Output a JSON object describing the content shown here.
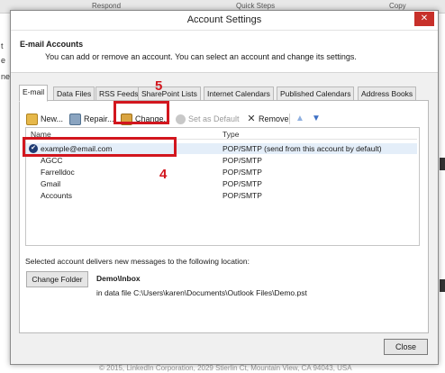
{
  "background": {
    "ribbon_items": [
      "Respond",
      "Quick Steps",
      "Copy"
    ],
    "left_fragments": [
      "t",
      "e",
      "ne"
    ],
    "footer": "© 2015, LinkedIn Corporation, 2029 Stierlin Ct, Mountain View, CA 94043, USA"
  },
  "dialog": {
    "title": "Account Settings",
    "close_glyph": "✕",
    "header_title": "E-mail Accounts",
    "header_subtitle": "You can add or remove an account. You can select an account and change its settings."
  },
  "tabs": [
    {
      "label": "E-mail",
      "active": true
    },
    {
      "label": "Data Files"
    },
    {
      "label": "RSS Feeds"
    },
    {
      "label": "SharePoint Lists"
    },
    {
      "label": "Internet Calendars"
    },
    {
      "label": "Published Calendars"
    },
    {
      "label": "Address Books"
    }
  ],
  "toolbar": {
    "new": "New...",
    "repair": "Repair...",
    "change": "Change...",
    "set_default": "Set as Default",
    "remove": "Remove",
    "move_up_icon": "arrow-up-icon",
    "move_down_icon": "arrow-down-icon"
  },
  "list": {
    "columns": [
      "Name",
      "Type"
    ],
    "rows": [
      {
        "name": "example@email.com",
        "type": "POP/SMTP (send from this account by default)",
        "default": true
      },
      {
        "name": "AGCC",
        "type": "POP/SMTP"
      },
      {
        "name": "Farrelldoc",
        "type": "POP/SMTP"
      },
      {
        "name": "Gmail",
        "type": "POP/SMTP"
      },
      {
        "name": "Accounts",
        "type": "POP/SMTP"
      }
    ]
  },
  "delivery": {
    "text": "Selected account delivers new messages to the following location:",
    "change_folder": "Change Folder",
    "folder": "Demo\\Inbox",
    "data_file": "in data file C:\\Users\\karen\\Documents\\Outlook Files\\Demo.pst"
  },
  "close_button": "Close",
  "annotations": {
    "step_change": "5",
    "step_account": "4",
    "color": "#d2161e"
  }
}
